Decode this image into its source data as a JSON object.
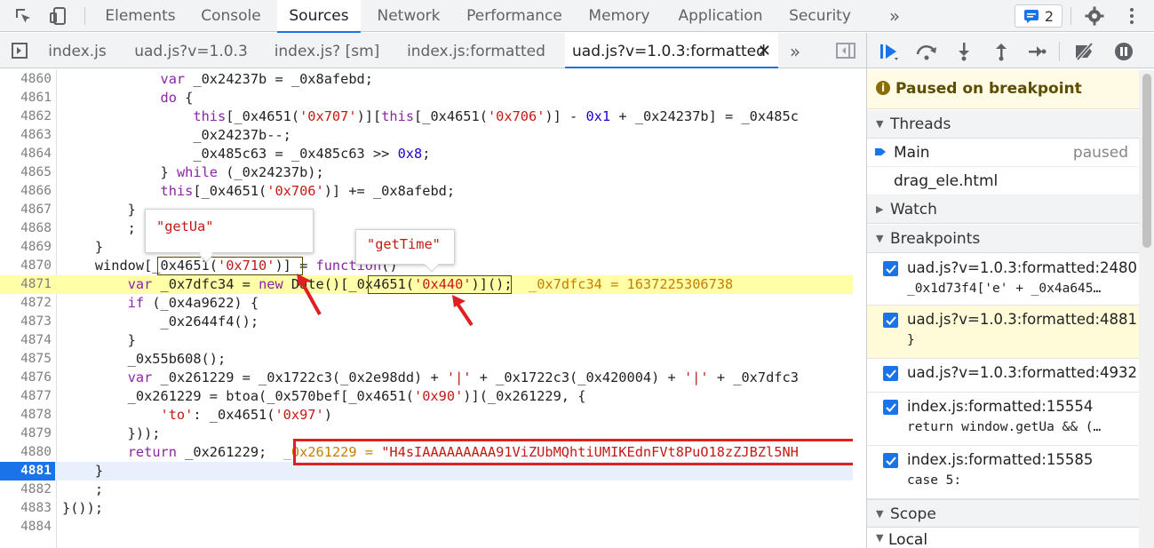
{
  "panel_tabs": [
    "Elements",
    "Console",
    "Sources",
    "Network",
    "Performance",
    "Memory",
    "Application",
    "Security"
  ],
  "active_panel": "Sources",
  "issues_count": "2",
  "file_tabs": [
    "index.js",
    "uad.js?v=1.0.3",
    "index.js? [sm]",
    "index.js:formatted",
    "uad.js?v=1.0.3:formatted"
  ],
  "active_file": "uad.js?v=1.0.3:formatted",
  "code_lines": [
    {
      "n": "4860",
      "html": "            <span class='kw'>var</span> _0x24237b = _0x8afebd;"
    },
    {
      "n": "4861",
      "html": "            <span class='kw'>do</span> {"
    },
    {
      "n": "4862",
      "html": "                <span class='kw'>this</span>[_0x4651(<span class='str'>'0x707'</span>)][<span class='kw'>this</span>[_0x4651(<span class='str'>'0x706'</span>)] - <span class='num'>0x1</span> + _0x24237b] = _0x485c"
    },
    {
      "n": "4863",
      "html": "                _0x24237b--;"
    },
    {
      "n": "4864",
      "html": "                _0x485c63 = _0x485c63 &gt;&gt; <span class='num'>0x8</span>;"
    },
    {
      "n": "4865",
      "html": "            } <span class='kw'>while</span> (_0x24237b);"
    },
    {
      "n": "4866",
      "html": "            <span class='kw'>this</span>[_0x4651(<span class='str'>'0x706'</span>)] += _0x8afebd;"
    },
    {
      "n": "4867",
      "html": "        }"
    },
    {
      "n": "4868",
      "html": "        ;"
    },
    {
      "n": "4869",
      "html": "    }"
    },
    {
      "n": "4870",
      "html": "    window[_0x4651(<span class='str'>'0x710'</span>)] = <span class='kw'>function</span>()"
    },
    {
      "n": "4871",
      "html": "        <span class='kw'>var</span> _0x7dfc34 = <span class='kw'>new</span> Date()[_0x4651(<span class='str'>'0x440'</span>)]();  <span class='inline-val'>_0x7dfc34 = 1637225306738</span>"
    },
    {
      "n": "4872",
      "html": "        <span class='kw'>if</span> (_0x4a9622) {"
    },
    {
      "n": "4873",
      "html": "            _0x2644f4();"
    },
    {
      "n": "4874",
      "html": "        }"
    },
    {
      "n": "4875",
      "html": "        _0x55b608();"
    },
    {
      "n": "4876",
      "html": "        <span class='kw'>var</span> _0x261229 = _0x1722c3(_0x2e98dd) + <span class='str'>'|'</span> + _0x1722c3(_0x420004) + <span class='str'>'|'</span> + _0x7dfc3"
    },
    {
      "n": "4877",
      "html": "        _0x261229 = btoa(_0x570bef[_0x4651(<span class='str'>'0x90'</span>)](_0x261229, {"
    },
    {
      "n": "4878",
      "html": "            <span class='str'>'to'</span>: _0x4651(<span class='str'>'0x97'</span>)"
    },
    {
      "n": "4879",
      "html": "        }));"
    },
    {
      "n": "4880",
      "html": "        <span class='kw'>return</span> _0x261229;  <span class='inline-val'>_0x261229 = <span class='str'>\"H4sIAAAAAAAAA91ViZUbMQhtiUMIKEdnFVt8PuO18zZJBZl5NH</span></span>"
    },
    {
      "n": "4881",
      "html": "    }"
    },
    {
      "n": "4882",
      "html": "    ;"
    },
    {
      "n": "4883",
      "html": "}());"
    },
    {
      "n": "4884",
      "html": ""
    }
  ],
  "popovers": {
    "get_ua": "\"getUa\"",
    "get_time": "\"getTime\""
  },
  "paused_message": "Paused on breakpoint",
  "threads": {
    "title": "Threads",
    "main": "Main",
    "main_status": "paused",
    "file": "drag_ele.html"
  },
  "watch_title": "Watch",
  "breakpoints_title": "Breakpoints",
  "breakpoints": [
    {
      "loc": "uad.js?v=1.0.3:formatted:2480",
      "code": "_0x1d73f4['e' + _0x4a645…"
    },
    {
      "loc": "uad.js?v=1.0.3:formatted:4881",
      "code": "}"
    },
    {
      "loc": "uad.js?v=1.0.3:formatted:4932",
      "code": ""
    },
    {
      "loc": "index.js:formatted:15554",
      "code": "return window.getUa && (…"
    },
    {
      "loc": "index.js:formatted:15585",
      "code": "case 5:"
    }
  ],
  "scope_title": "Scope",
  "local_title": "Local",
  "colors": {
    "accent": "#1a73e8",
    "highlight": "#ffffa8",
    "paused_bg": "#fffbe5",
    "annotation": "#e02020"
  }
}
